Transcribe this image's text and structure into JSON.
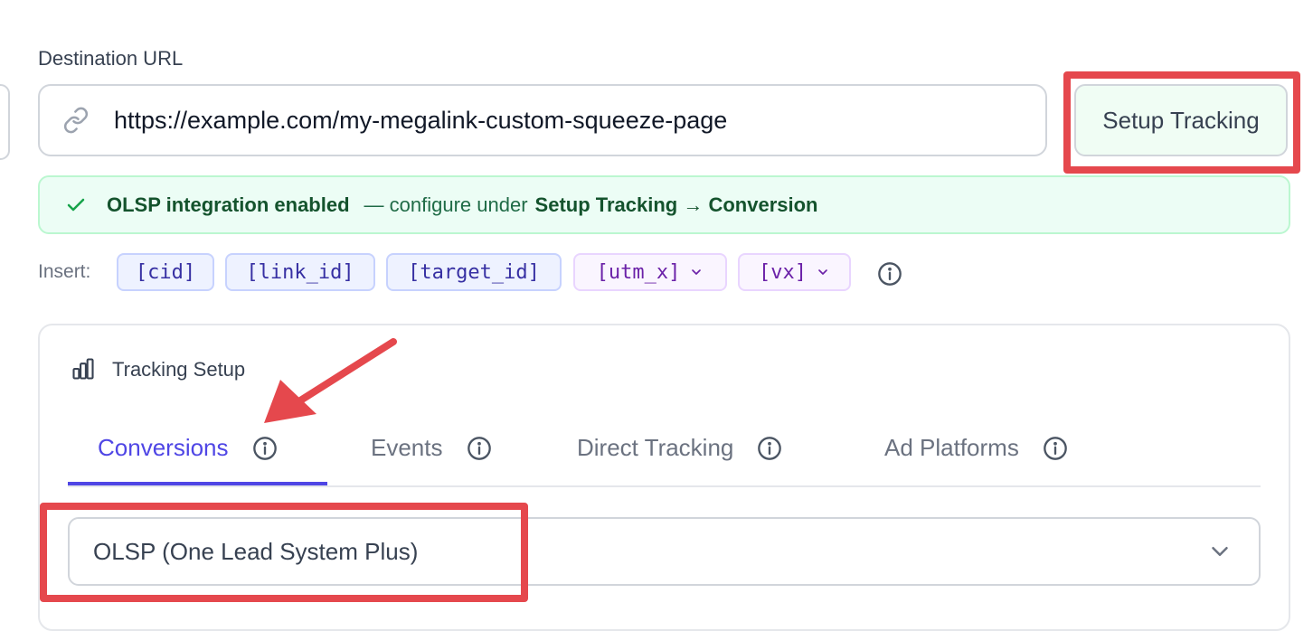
{
  "destination": {
    "label": "Destination URL",
    "url_value": "https://example.com/my-megalink-custom-squeeze-page",
    "link_icon": "link-icon"
  },
  "setup_tracking": {
    "label": "Setup Tracking"
  },
  "banner": {
    "icon": "check-icon",
    "title": "OLSP integration enabled",
    "text": "— configure under",
    "path": "Setup Tracking → Conversion",
    "color": "#166534"
  },
  "insert": {
    "label": "Insert:",
    "chips": [
      {
        "label": "[cid]"
      },
      {
        "label": "[link_id]"
      },
      {
        "label": "[target_id]"
      },
      {
        "label": "[utm_x]"
      },
      {
        "label": "[vx]"
      }
    ]
  },
  "tracking_setup": {
    "title": "Tracking Setup",
    "icon": "bar-chart-icon",
    "tabs": [
      {
        "label": "Conversions"
      },
      {
        "label": "Events"
      },
      {
        "label": "Direct Tracking"
      },
      {
        "label": "Ad Platforms"
      }
    ],
    "active_tab": "Conversions",
    "select_value": "OLSP (One Lead System Plus)"
  },
  "colors": {
    "accent": "#4f46e5",
    "annotation_red": "#e5484d"
  }
}
